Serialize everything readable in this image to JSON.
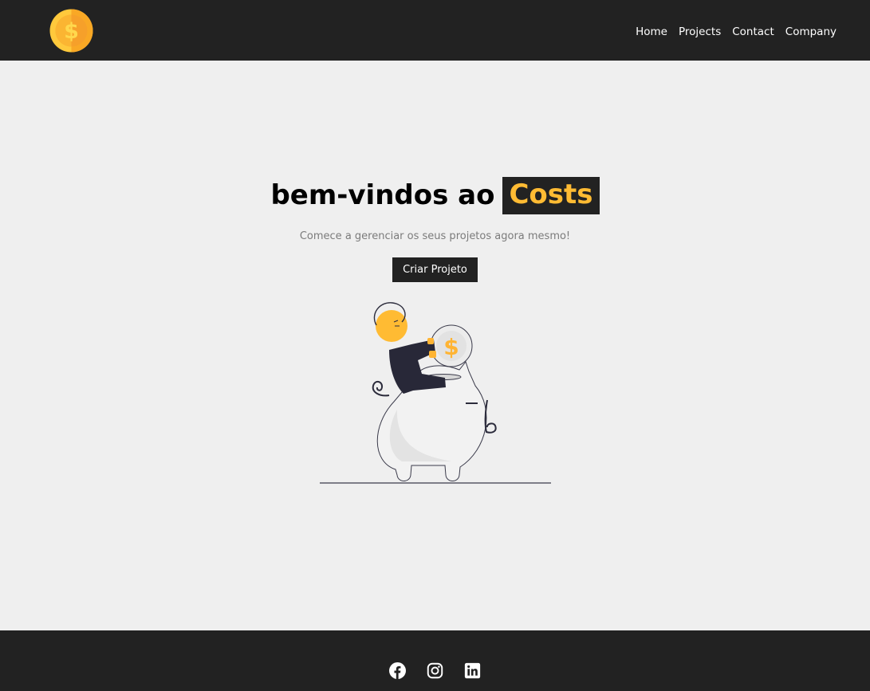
{
  "navbar": {
    "logo_icon": "dollar-coin-icon",
    "links": [
      "Home",
      "Projects",
      "Contact",
      "Company"
    ]
  },
  "hero": {
    "title_prefix": "bem-vindos ao",
    "title_brand": "Costs",
    "subtitle": "Comece a gerenciar os seus projetos agora mesmo!",
    "cta_label": "Criar Projeto",
    "illustration": "person-saving-coin-in-piggy-bank"
  },
  "footer": {
    "social_icons": [
      "facebook-icon",
      "instagram-icon",
      "linkedin-icon"
    ]
  },
  "colors": {
    "dark": "#222222",
    "accent": "#ffbb33",
    "background": "#efefef"
  }
}
